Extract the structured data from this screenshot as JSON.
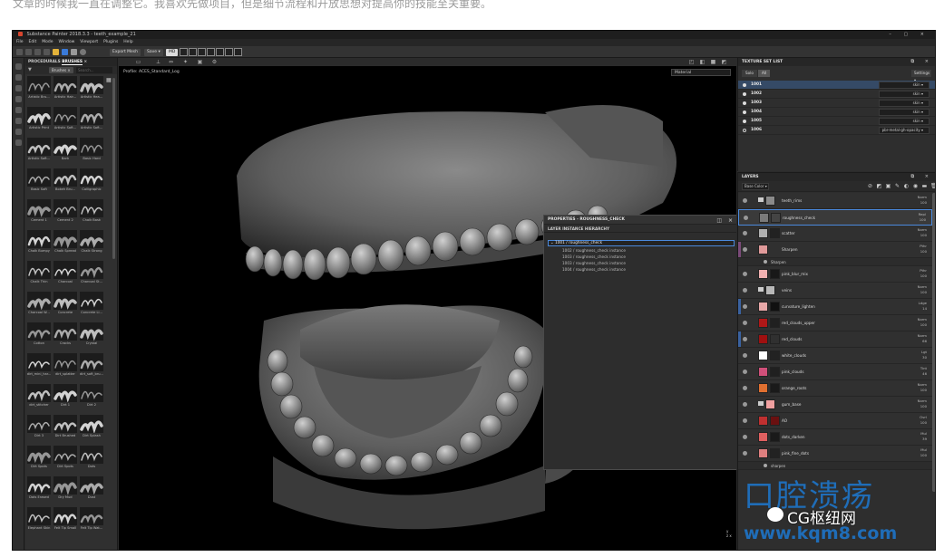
{
  "caption": "文章的时候我一直在调整它。我喜欢先做项目，但是细节流程和开放思想对提高你的技能至关重要。",
  "window": {
    "title": "Substance Painter 2018.3.3 - teeth_example_21",
    "controls": "– ▢ ×"
  },
  "menu": [
    "File",
    "Edit",
    "Mode",
    "Window",
    "Viewport",
    "Plugins",
    "Help"
  ],
  "toolbar": {
    "export_label": "Export Mesh",
    "save_label": "Save ▾",
    "mode_label": "MD"
  },
  "shelf": {
    "tab_procedurals": "PROCEDURALS",
    "tab_brushes": "BRUSHES",
    "tab_close": "×",
    "filter_tag": "Brushes ×",
    "search_placeholder": "Search...",
    "brushes": [
      "Artistic Bru...",
      "Artistic Hair...",
      "Artistic Hea...",
      "Artistic Print",
      "Artistic Soft...",
      "Artistic Soft...",
      "Artistic Soft...",
      "Bark",
      "Basic Hard",
      "Basic Soft",
      "Bokeh Bru...",
      "Calligraphic",
      "Cement 1",
      "Cement 2",
      "Chalk Bask",
      "Chalk Bumpy",
      "Chalk Spread",
      "Chalk Strong",
      "Chalk Thin",
      "Charcoal",
      "Charcoal St...",
      "Charcoal W...",
      "Concrete",
      "Concrete Li...",
      "Cotton",
      "Cracks",
      "Crystal",
      "dirt_mini_har...",
      "dirt_splatter",
      "dirt_soft_bru...",
      "dirt_stitcher",
      "Dirt 1",
      "Dirt 2",
      "Dirt 3",
      "Dirt Brushed",
      "Dirt Splash",
      "Dirt Spots",
      "Dirt Spots",
      "Dots",
      "Dots Erased",
      "Dry Mud",
      "Dust",
      "Elephant Skin",
      "Felt Tip Small",
      "Felt Tip Wat..."
    ]
  },
  "viewport": {
    "profile": "Profile: ACES_Standard_Log",
    "channel": "Material",
    "axis_x": "x",
    "axis_y": "y",
    "axis_z": "z"
  },
  "properties": {
    "title": "PROPERTIES - ROUGHNESS_CHECK",
    "section": "LAYER INSTANCE HIERARCHY",
    "root": "1001 / roughness_check",
    "children": [
      "1002 / roughness_check instance",
      "1003 / roughness_check instance",
      "1003 / roughness_check instance",
      "1004 / roughness_check instance"
    ]
  },
  "texture_set_list": {
    "title": "TEXTURE SET LIST",
    "tabs": [
      "Solo",
      "All"
    ],
    "settings": "Settings ▾",
    "rows": [
      {
        "name": "1001",
        "shader": "skin ▾"
      },
      {
        "name": "1002",
        "shader": "skin ▾"
      },
      {
        "name": "1003",
        "shader": "skin ▾"
      },
      {
        "name": "1004",
        "shader": "skin ▾"
      },
      {
        "name": "1005",
        "shader": "skin ▾"
      },
      {
        "name": "1006",
        "shader": "pbr-metal-gh-opacity ▾"
      }
    ]
  },
  "layers": {
    "title": "LAYERS",
    "channel": "Base Color ▾",
    "rows": [
      {
        "name": "teeth_rims",
        "blend": "Norm",
        "op": "100",
        "t1": "#8a8a8a",
        "t2": "#5a5a5a",
        "accent": "",
        "folder": true
      },
      {
        "name": "roughness_check",
        "blend": "Repl",
        "op": "100",
        "t1": "#7a7a7a",
        "t2": "#444444",
        "accent": "",
        "folder": false
      },
      {
        "name": "scatter",
        "blend": "Norm",
        "op": "100",
        "t1": "#b0b0b0",
        "t2": "#222222",
        "accent": "",
        "folder": false
      },
      {
        "name": "Sharpen",
        "blend": "Pthr",
        "op": "100",
        "t1": "#e09a9a",
        "t2": "",
        "accent": "#7a4a78",
        "folder": false
      },
      {
        "name": "pink_blur_mix",
        "blend": "Pthr",
        "op": "100",
        "t1": "#f0b0b0",
        "t2": "#181818",
        "accent": "",
        "folder": false
      },
      {
        "name": "veins",
        "blend": "Norm",
        "op": "100",
        "t1": "#b8b8b8",
        "t2": "",
        "accent": "",
        "folder": true
      },
      {
        "name": "curvature_lighten",
        "blend": "Ldge",
        "op": "14",
        "t1": "#e8a8a8",
        "t2": "#111111",
        "accent": "#3a62a0",
        "folder": false
      },
      {
        "name": "red_clouds_upper",
        "blend": "Norm",
        "op": "100",
        "t1": "#b01818",
        "t2": "#202020",
        "accent": "",
        "folder": false
      },
      {
        "name": "red_clouds",
        "blend": "Norm",
        "op": "66",
        "t1": "#a01010",
        "t2": "#303030",
        "accent": "#3a62a0",
        "folder": false
      },
      {
        "name": "white_clouds",
        "blend": "Lgt",
        "op": "30",
        "t1": "#ffffff",
        "t2": "#222222",
        "accent": "",
        "folder": false
      },
      {
        "name": "pink_clouds",
        "blend": "Tint",
        "op": "46",
        "t1": "#d0507a",
        "t2": "#202020",
        "accent": "",
        "folder": false
      },
      {
        "name": "orange_roots",
        "blend": "Norm",
        "op": "100",
        "t1": "#e07030",
        "t2": "#1a1a1a",
        "accent": "",
        "folder": false
      },
      {
        "name": "gum_base",
        "blend": "Norm",
        "op": "100",
        "t1": "#f0a0a0",
        "t2": "",
        "accent": "",
        "folder": true
      },
      {
        "name": "AO",
        "blend": "Ovrl",
        "op": "100",
        "t1": "#c03030",
        "t2": "#6a1010",
        "accent": "",
        "folder": false
      },
      {
        "name": "dots_darken",
        "blend": "Mul",
        "op": "39",
        "t1": "#e06060",
        "t2": "#1a1a1a",
        "accent": "",
        "folder": false
      },
      {
        "name": "pink_fine_dots",
        "blend": "Mul",
        "op": "100",
        "t1": "#e08080",
        "t2": "#222222",
        "accent": "",
        "folder": false
      }
    ],
    "effects": [
      {
        "after": 3,
        "name": "Sharpen"
      },
      {
        "after": 15,
        "name": "sharpen"
      }
    ]
  },
  "watermark": {
    "cn": "口腔溃疡",
    "brand": "CG枢纽网",
    "url": "www.kqm8.com"
  }
}
